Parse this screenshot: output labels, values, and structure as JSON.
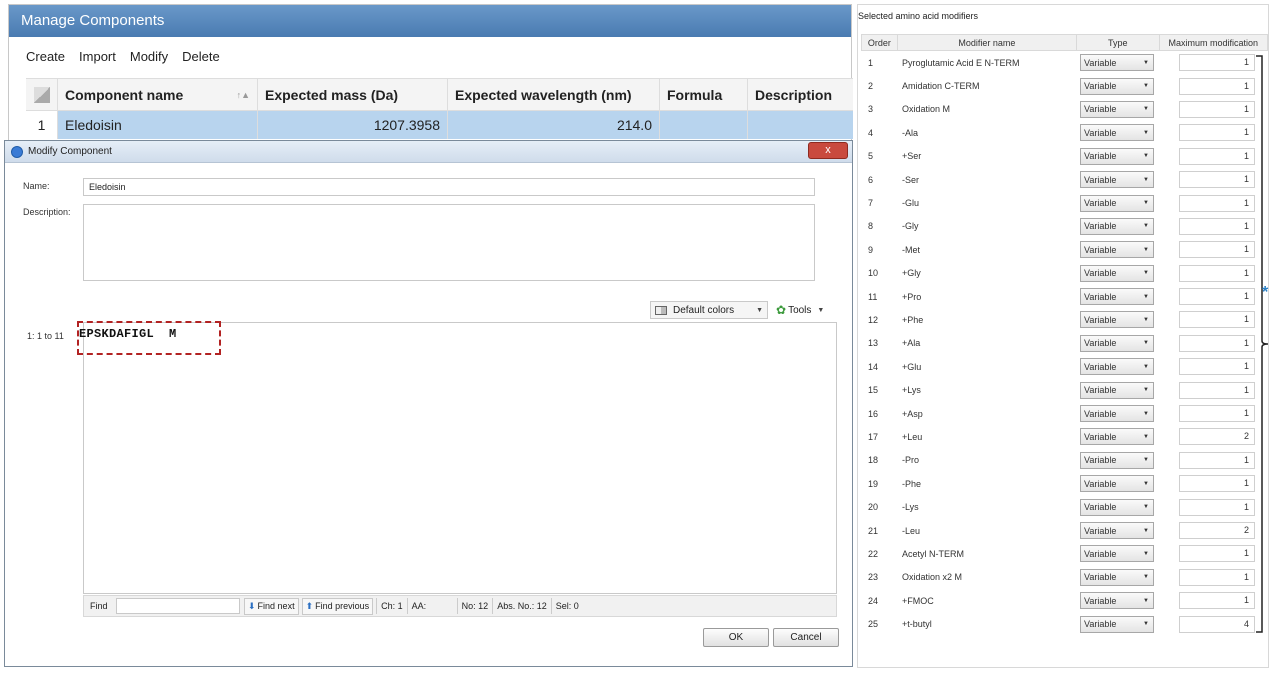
{
  "manage": {
    "title": "Manage Components",
    "menu": [
      "Create",
      "Import",
      "Modify",
      "Delete"
    ],
    "columns": [
      "Component name",
      "Expected mass (Da)",
      "Expected wavelength (nm)",
      "Formula",
      "Description"
    ],
    "row": {
      "index": "1",
      "name": "Eledoisin",
      "mass": "1207.3958",
      "wavelength": "214.0",
      "formula": "",
      "description": ""
    }
  },
  "modify": {
    "title": "Modify Component",
    "name_label": "Name:",
    "name_value": "Eledoisin",
    "description_label": "Description:",
    "description_value": "",
    "default_colors": "Default colors",
    "tools": "Tools",
    "range": "1: 1 to 11",
    "sequence": "EPSKDAFIGL  M",
    "find_label": "Find",
    "find_next": "Find next",
    "find_previous": "Find previous",
    "status": [
      "Ch: 1",
      "AA:",
      "No: 12",
      "Abs. No.: 12",
      "Sel: 0"
    ],
    "ok": "OK",
    "cancel": "Cancel",
    "close": "x"
  },
  "modifiers": {
    "title": "Selected amino acid modifiers",
    "columns": [
      "Order",
      "Modifier name",
      "Type",
      "Maximum modification"
    ],
    "rows": [
      {
        "order": "1",
        "name": "Pyroglutamic Acid E N-TERM",
        "type": "Variable",
        "max": "1"
      },
      {
        "order": "2",
        "name": "Amidation C-TERM",
        "type": "Variable",
        "max": "1"
      },
      {
        "order": "3",
        "name": "Oxidation M",
        "type": "Variable",
        "max": "1"
      },
      {
        "order": "4",
        "name": "-Ala",
        "type": "Variable",
        "max": "1"
      },
      {
        "order": "5",
        "name": "+Ser",
        "type": "Variable",
        "max": "1"
      },
      {
        "order": "6",
        "name": "-Ser",
        "type": "Variable",
        "max": "1"
      },
      {
        "order": "7",
        "name": "-Glu",
        "type": "Variable",
        "max": "1"
      },
      {
        "order": "8",
        "name": "-Gly",
        "type": "Variable",
        "max": "1"
      },
      {
        "order": "9",
        "name": "-Met",
        "type": "Variable",
        "max": "1"
      },
      {
        "order": "10",
        "name": "+Gly",
        "type": "Variable",
        "max": "1"
      },
      {
        "order": "11",
        "name": "+Pro",
        "type": "Variable",
        "max": "1"
      },
      {
        "order": "12",
        "name": "+Phe",
        "type": "Variable",
        "max": "1"
      },
      {
        "order": "13",
        "name": "+Ala",
        "type": "Variable",
        "max": "1"
      },
      {
        "order": "14",
        "name": "+Glu",
        "type": "Variable",
        "max": "1"
      },
      {
        "order": "15",
        "name": "+Lys",
        "type": "Variable",
        "max": "1"
      },
      {
        "order": "16",
        "name": "+Asp",
        "type": "Variable",
        "max": "1"
      },
      {
        "order": "17",
        "name": "+Leu",
        "type": "Variable",
        "max": "2"
      },
      {
        "order": "18",
        "name": "-Pro",
        "type": "Variable",
        "max": "1"
      },
      {
        "order": "19",
        "name": "-Phe",
        "type": "Variable",
        "max": "1"
      },
      {
        "order": "20",
        "name": "-Lys",
        "type": "Variable",
        "max": "1"
      },
      {
        "order": "21",
        "name": "-Leu",
        "type": "Variable",
        "max": "2"
      },
      {
        "order": "22",
        "name": "Acetyl N-TERM",
        "type": "Variable",
        "max": "1"
      },
      {
        "order": "23",
        "name": "Oxidation x2 M",
        "type": "Variable",
        "max": "1"
      },
      {
        "order": "24",
        "name": "+FMOC",
        "type": "Variable",
        "max": "1"
      },
      {
        "order": "25",
        "name": "+t-butyl",
        "type": "Variable",
        "max": "4"
      }
    ]
  },
  "annotation": {
    "marker": "*",
    "color": "#2a7fc4",
    "highlight_color": "#b22222"
  }
}
